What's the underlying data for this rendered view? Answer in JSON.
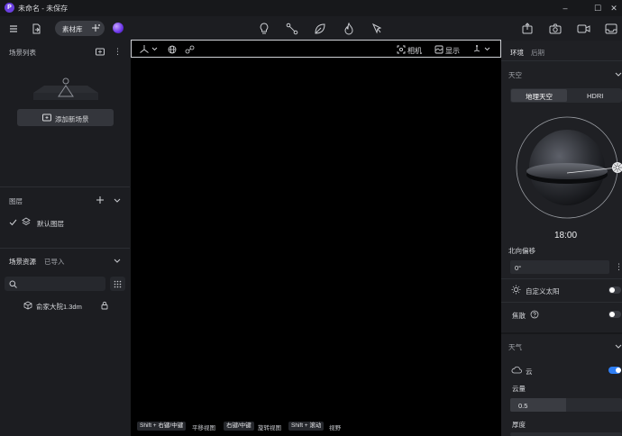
{
  "app": {
    "title": "未命名 - 未保存",
    "logo_letter": "P"
  },
  "toolbar": {
    "assets_label": "素材库"
  },
  "left_panel": {
    "scene_list_title": "场景列表",
    "add_scene_label": "添加新场景",
    "layers_title": "图层",
    "layers": [
      {
        "label": "默认图层",
        "visible": true
      }
    ],
    "assets_tab_active": "场景资源",
    "assets_tab_inactive": "已导入",
    "asset_items": [
      {
        "label": "俞家大院1.3dm"
      }
    ]
  },
  "viewport": {
    "camera_label": "相机",
    "display_label": "显示",
    "hints": [
      {
        "key": "Shift + 右键/中键",
        "action": "平移视图"
      },
      {
        "key": "右键/中键",
        "action": "旋转视图"
      },
      {
        "key": "Shift + 滚动",
        "action": "视野"
      }
    ]
  },
  "right_panel": {
    "tabs": [
      "环境",
      "后期"
    ],
    "active_tab": "环境",
    "sky_section": "天空",
    "sky_modes": [
      "地理天空",
      "HDRI"
    ],
    "active_sky_mode": "地理天空",
    "time": "18:00",
    "north_offset_label": "北向偏移",
    "north_offset_value": "0°",
    "custom_sun_label": "自定义太阳",
    "custom_sun_on": false,
    "caustics_label": "焦散",
    "caustics_on": false,
    "weather_section": "天气",
    "cloud_label": "云",
    "cloud_on": true,
    "cloud_amount_label": "云量",
    "cloud_amount_value": "0.5",
    "thickness_label": "厚度",
    "accent_color": "#2f7ff5"
  }
}
